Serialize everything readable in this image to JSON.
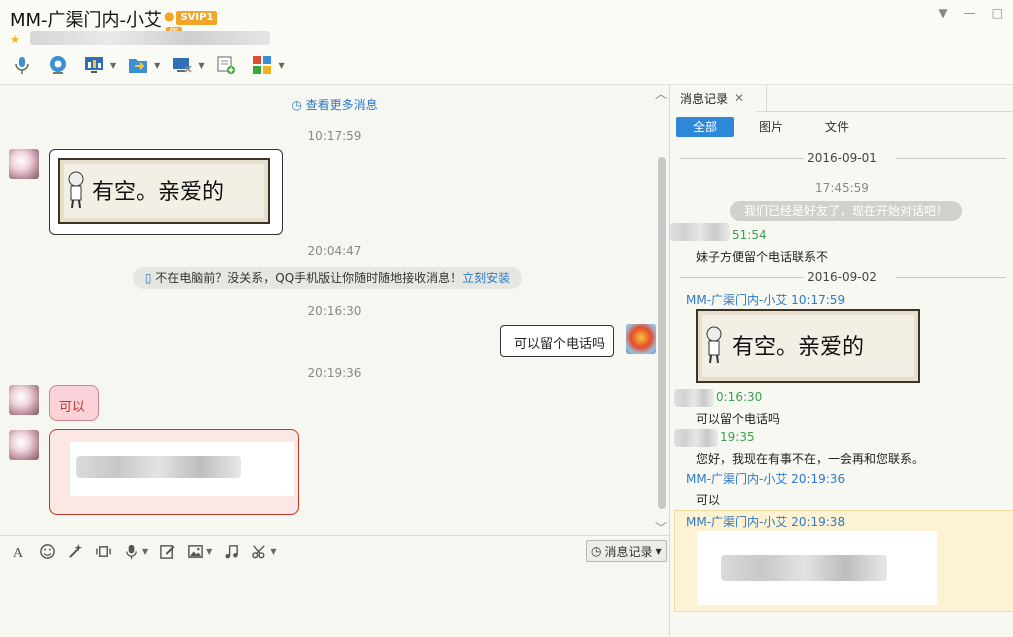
{
  "header": {
    "title": "MM-广渠门内-小艾",
    "vip_label": "SVIP1",
    "year_label": "年",
    "toolbar_icons": [
      "microphone-icon",
      "video-call-icon",
      "screen-share-icon",
      "file-transfer-icon",
      "remote-desktop-icon",
      "new-message-icon",
      "apps-icon"
    ]
  },
  "chat": {
    "more_messages": "查看更多消息",
    "messages": [
      {
        "time": "10:17:59",
        "sticker_text": "有空。亲爱的"
      },
      {
        "time": "20:04:47"
      },
      {
        "time": "20:16:30",
        "text": "可以留个电话吗"
      },
      {
        "time": "20:19:36",
        "text": "可以"
      }
    ],
    "tip_text": "不在电脑前？没关系，QQ手机版让你随时随地接收消息！",
    "tip_link": "立刻安装"
  },
  "input": {
    "history_button": "消息记录"
  },
  "history": {
    "tab_label": "消息记录",
    "filters": [
      "全部",
      "图片",
      "文件"
    ],
    "entries": {
      "date1": "2016-09-01",
      "time1": "17:45:59",
      "system_msg": "我们已经是好友了，现在开始对话吧！",
      "time2": "51:54",
      "msg2": "妹子方便留个电话联系不",
      "date2": "2016-09-02",
      "sender3": "MM-广渠门内-小艾 10:17:59",
      "sticker_text": "有空。亲爱的",
      "time4": "0:16:30",
      "msg4": "可以留个电话吗",
      "time5": "19:35",
      "msg5": "您好，我现在有事不在，一会再和您联系。",
      "sender6": "MM-广渠门内-小艾 20:19:36",
      "msg6": "可以",
      "sender7": "MM-广渠门内-小艾 20:19:38"
    }
  },
  "colors": {
    "accent": "#2f87d8",
    "link": "#2f78c8",
    "green_time": "#3b9e53",
    "highlight_bg": "#fdf3d4"
  }
}
